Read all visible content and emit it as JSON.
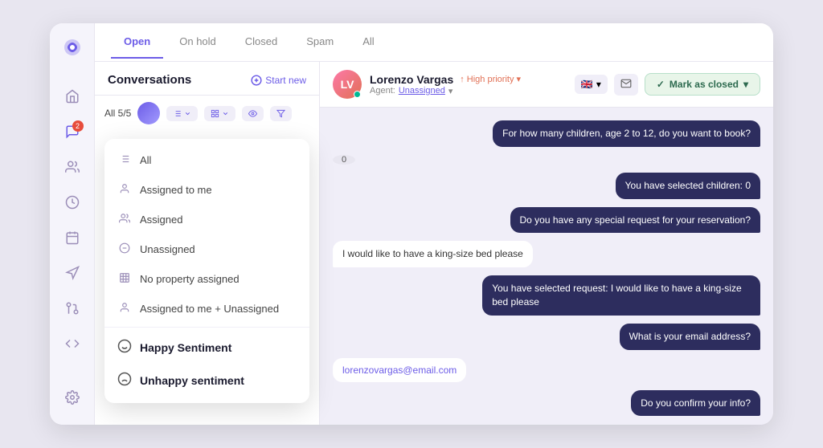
{
  "tabs": {
    "items": [
      {
        "label": "Open",
        "active": true
      },
      {
        "label": "On hold",
        "active": false
      },
      {
        "label": "Closed",
        "active": false
      },
      {
        "label": "Spam",
        "active": false
      },
      {
        "label": "All",
        "active": false
      }
    ]
  },
  "conversations": {
    "title": "Conversations",
    "start_new": "Start new",
    "all_label": "All 5/5"
  },
  "dropdown": {
    "items": [
      {
        "label": "All",
        "icon": "list"
      },
      {
        "label": "Assigned to me",
        "icon": "person"
      },
      {
        "label": "Assigned",
        "icon": "people"
      },
      {
        "label": "Unassigned",
        "icon": "minus-circle"
      },
      {
        "label": "No property assigned",
        "icon": "building"
      },
      {
        "label": "Assigned to me + Unassigned",
        "icon": "person-plus"
      },
      {
        "label": "Happy Sentiment",
        "icon": "smile",
        "bold": true
      },
      {
        "label": "Unhappy sentiment",
        "icon": "frown",
        "bold": true
      }
    ]
  },
  "chat": {
    "user_name": "Lorenzo Vargas",
    "priority": "High priority",
    "agent_label": "Agent:",
    "agent_value": "Unassigned",
    "mark_closed": "Mark as closed",
    "messages": [
      {
        "type": "bot",
        "text": "For how many children, age 2 to 12, do you want to book?"
      },
      {
        "type": "badge",
        "text": "0"
      },
      {
        "type": "user",
        "text": "You have selected children: 0"
      },
      {
        "type": "user",
        "text": "Do you have any special request for your reservation?"
      },
      {
        "type": "bot",
        "text": "I would like to have a king-size bed please"
      },
      {
        "type": "user",
        "text": "You have selected request: I would like to have a king-size bed please"
      },
      {
        "type": "user",
        "text": "What is your email address?"
      },
      {
        "type": "bot_email",
        "text": "lorenzovargas@email.com"
      },
      {
        "type": "user",
        "text": "Do you confirm your info?"
      }
    ]
  },
  "sidebar": {
    "icons": [
      "home",
      "chat",
      "users",
      "chart",
      "calendar",
      "megaphone",
      "git",
      "code",
      "settings"
    ]
  }
}
